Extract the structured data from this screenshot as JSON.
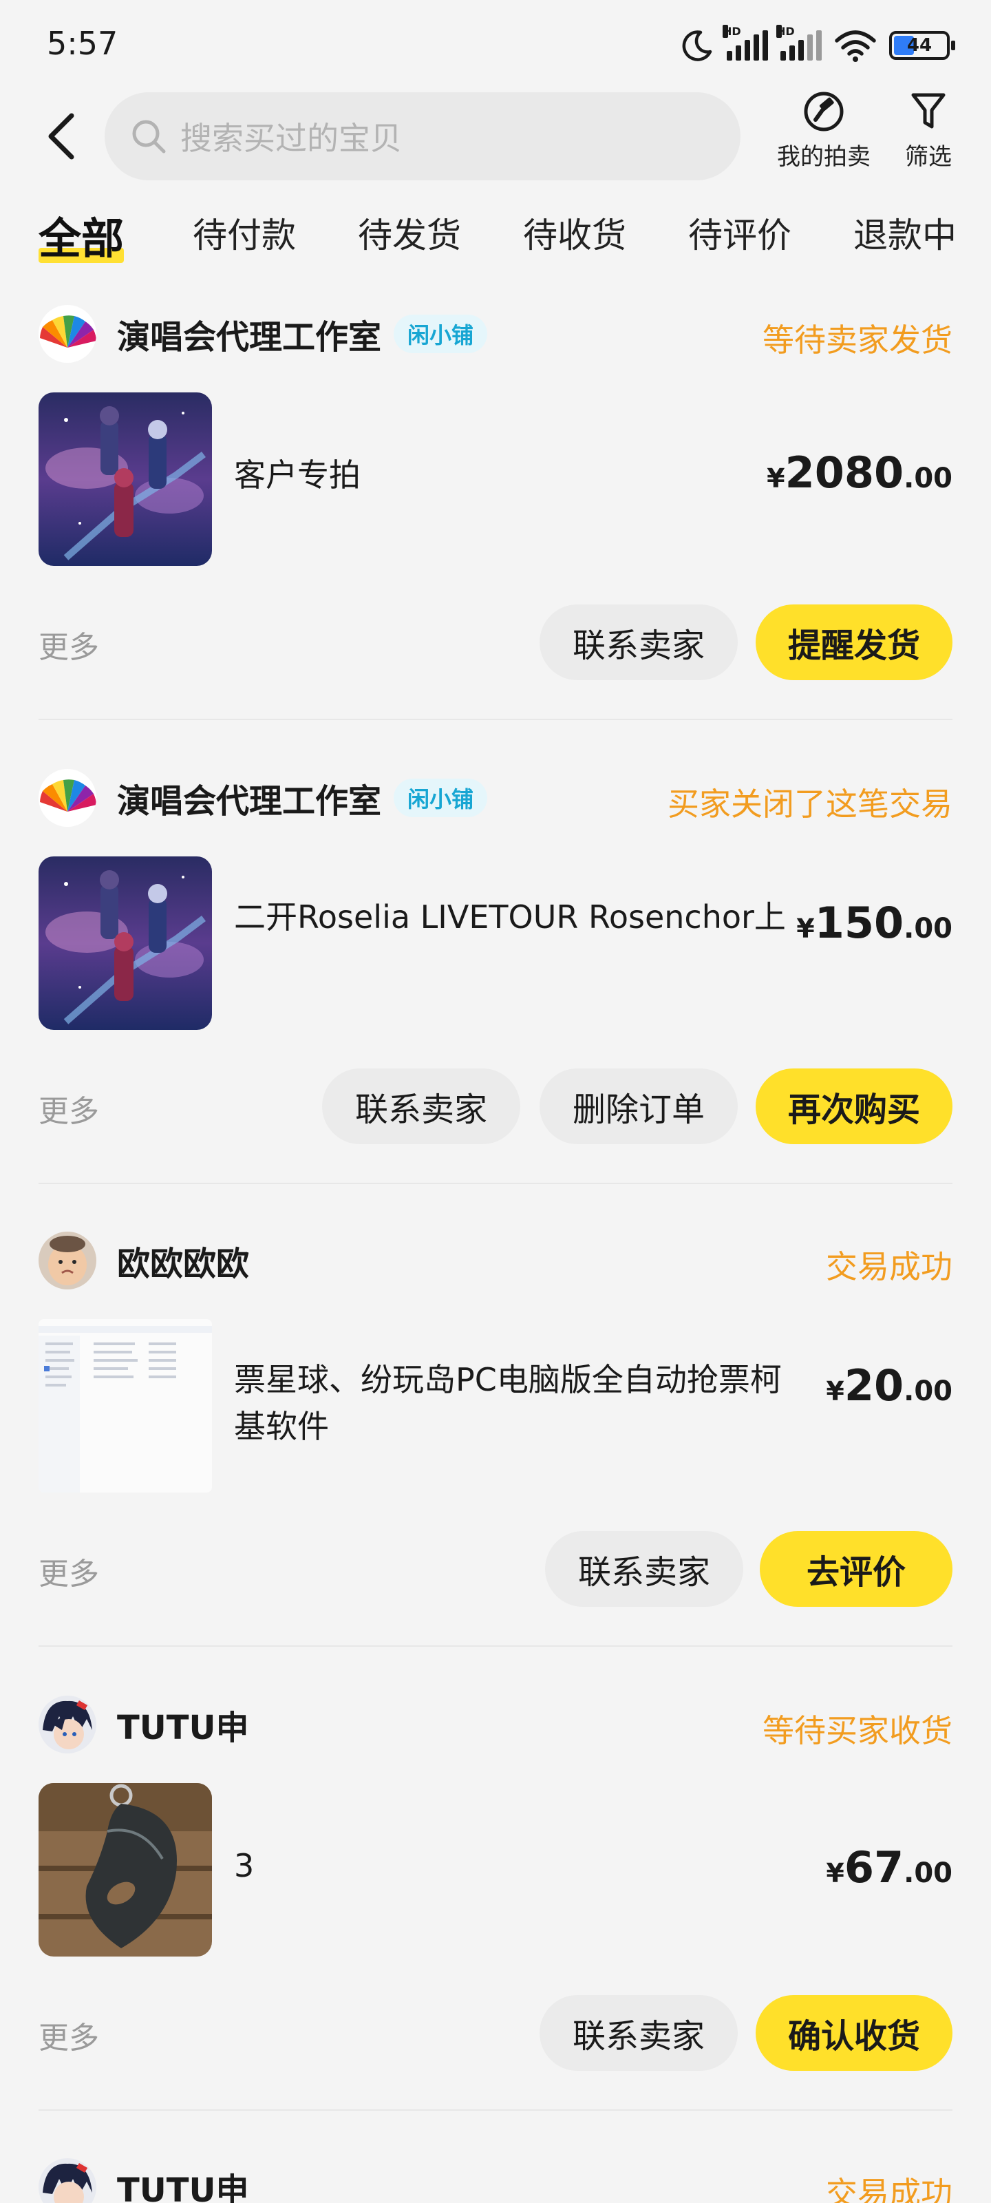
{
  "status_bar": {
    "time": "5:57",
    "battery": "44",
    "network_badge": "HD",
    "icons": [
      "moon-icon",
      "signal-icon",
      "signal-icon",
      "wifi-icon",
      "battery-icon"
    ]
  },
  "header": {
    "search_placeholder": "搜索买过的宝贝",
    "auction_label": "我的拍卖",
    "filter_label": "筛选"
  },
  "tabs": [
    "全部",
    "待付款",
    "待发货",
    "待收货",
    "待评价",
    "退款中"
  ],
  "active_tab": "全部",
  "orders": [
    {
      "shop": "演唱会代理工作室",
      "badge": "闲小铺",
      "status": "等待卖家发货",
      "title": "客户专拍",
      "price_currency": "¥",
      "price_int": "2080",
      "price_dec": ".00",
      "more": "更多",
      "buttons": [
        "联系卖家",
        "提醒发货"
      ]
    },
    {
      "shop": "演唱会代理工作室",
      "badge": "闲小铺",
      "status": "买家关闭了这笔交易",
      "title": "二开Roselia LIVETOUR Rosenchor上",
      "price_currency": "¥",
      "price_int": "150",
      "price_dec": ".00",
      "more": "更多",
      "buttons": [
        "联系卖家",
        "删除订单",
        "再次购买"
      ]
    },
    {
      "shop": "欧欧欧欧",
      "status": "交易成功",
      "title": "票星球、纷玩岛PC电脑版全自动抢票柯基软件",
      "price_currency": "¥",
      "price_int": "20",
      "price_dec": ".00",
      "more": "更多",
      "buttons": [
        "联系卖家",
        "去评价"
      ]
    },
    {
      "shop": "TUTU申",
      "status": "等待买家收货",
      "title": "3",
      "price_currency": "¥",
      "price_int": "67",
      "price_dec": ".00",
      "more": "更多",
      "buttons": [
        "联系卖家",
        "确认收货"
      ]
    },
    {
      "shop": "TUTU申",
      "status": "交易成功"
    }
  ],
  "colors": {
    "accent_yellow": "#ffe02a",
    "status_orange": "#f29c1f",
    "badge_blue": "#17a6d3",
    "background": "#f4f4f4"
  }
}
